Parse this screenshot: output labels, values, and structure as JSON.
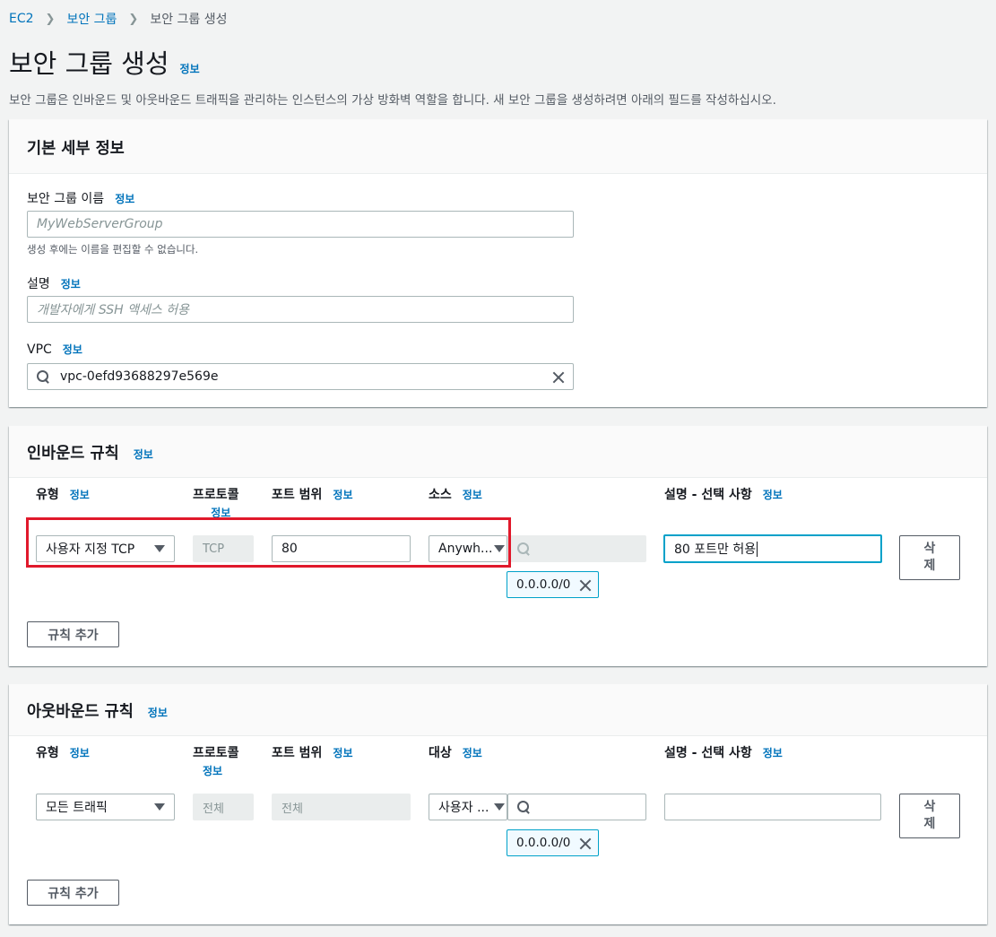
{
  "breadcrumb": {
    "ec2": "EC2",
    "security_groups": "보안 그룹",
    "current": "보안 그룹 생성"
  },
  "page": {
    "title": "보안 그룹 생성",
    "info": "정보",
    "description": "보안 그룹은 인바운드 및 아웃바운드 트래픽을 관리하는 인스턴스의 가상 방화벽 역할을 합니다. 새 보안 그룹을 생성하려면 아래의 필드를 작성하십시오."
  },
  "basic": {
    "header": "기본 세부 정보",
    "name_label": "보안 그룹 이름",
    "name_placeholder": "MyWebServerGroup",
    "name_hint": "생성 후에는 이름을 편집할 수 없습니다.",
    "desc_label": "설명",
    "desc_placeholder": "개발자에게 SSH 액세스 허용",
    "vpc_label": "VPC",
    "vpc_value": "vpc-0efd93688297e569e"
  },
  "inbound": {
    "header": "인바운드 규칙",
    "col_type": "유형",
    "col_protocol": "프로토콜",
    "col_port": "포트 범위",
    "col_source": "소스",
    "col_desc": "설명 - 선택 사항",
    "type_value": "사용자 지정 TCP",
    "protocol_value": "TCP",
    "port_value": "80",
    "source_value": "Anywh...",
    "cidr": "0.0.0.0/0",
    "desc_value": "80 포트만 허용",
    "delete_top": "삭",
    "delete_bottom": "제",
    "add_rule": "규칙 추가"
  },
  "outbound": {
    "header": "아웃바운드 규칙",
    "col_type": "유형",
    "col_protocol": "프로토콜",
    "col_port": "포트 범위",
    "col_dest": "대상",
    "col_desc": "설명 - 선택 사항",
    "type_value": "모든 트래픽",
    "protocol_value": "전체",
    "port_value": "전체",
    "dest_value": "사용자 ...",
    "cidr": "0.0.0.0/0",
    "desc_value": "",
    "delete_top": "삭",
    "delete_bottom": "제",
    "add_rule": "규칙 추가"
  },
  "colors": {
    "link": "#0073bb",
    "highlight": "#e0192b",
    "focus": "#00a1c9"
  }
}
